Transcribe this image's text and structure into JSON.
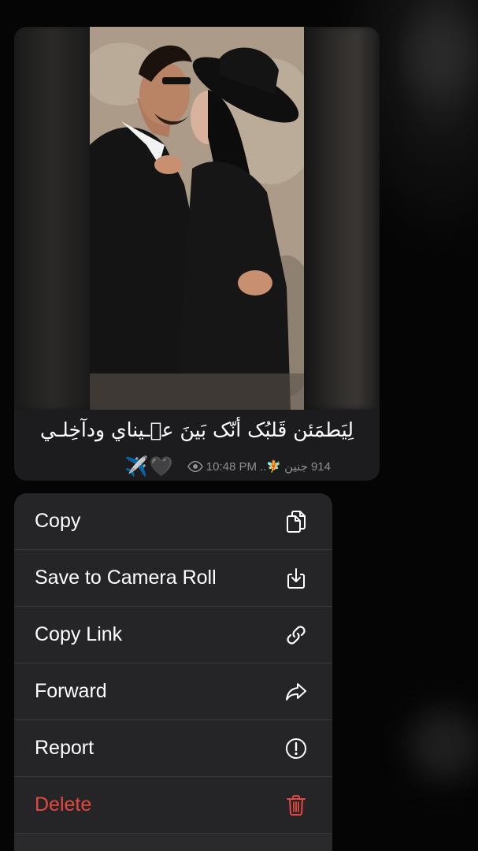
{
  "message": {
    "caption": "لِيَطمَئن قَلبُک أنّک بَينَ عٖـيناي ودآخِلـي",
    "emoji_tail": {
      "heart": "🖤",
      "plane": "✈️"
    },
    "views": "914",
    "sender_signature": "جنين 🧚..",
    "time": "10:48 PM"
  },
  "context_menu": {
    "items": [
      {
        "label": "Copy",
        "icon": "copy-icon"
      },
      {
        "label": "Save to Camera Roll",
        "icon": "download-icon"
      },
      {
        "label": "Copy Link",
        "icon": "link-icon"
      },
      {
        "label": "Forward",
        "icon": "forward-icon"
      },
      {
        "label": "Report",
        "icon": "report-icon"
      },
      {
        "label": "Delete",
        "icon": "trash-icon",
        "color": "#e5483d"
      }
    ]
  },
  "colors": {
    "danger": "#e5483d",
    "bubble_bg": "#1c1c1e",
    "menu_bg": "#252527"
  }
}
